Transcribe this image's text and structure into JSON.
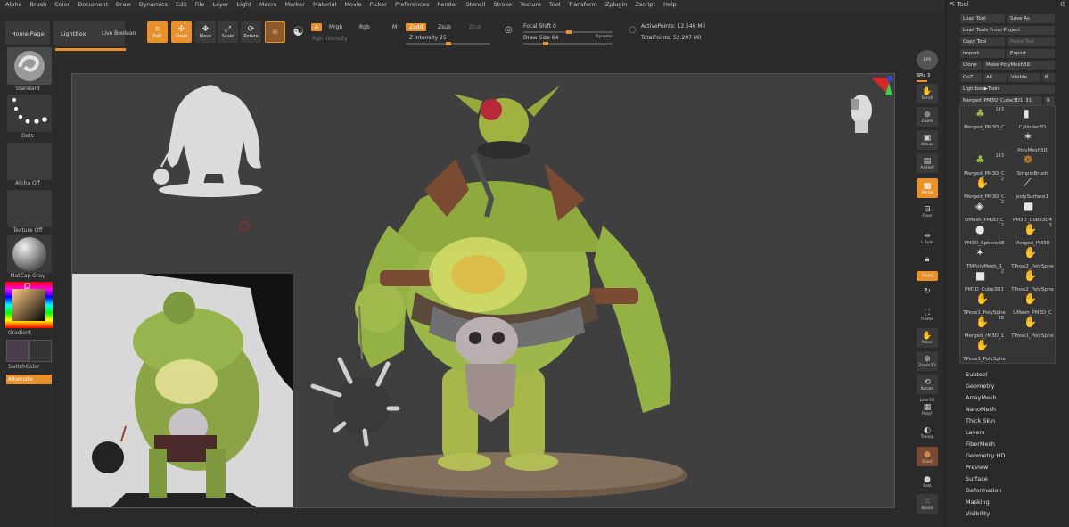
{
  "menubar": [
    "Alpha",
    "Brush",
    "Color",
    "Document",
    "Draw",
    "Dynamics",
    "Edit",
    "File",
    "Layer",
    "Light",
    "Macro",
    "Marker",
    "Material",
    "Movie",
    "Picker",
    "Preferences",
    "Render",
    "Stencil",
    "Stroke",
    "Texture",
    "Tool",
    "Transform",
    "Zplugin",
    "Zscript",
    "Help"
  ],
  "shelf": {
    "home_page": "Home Page",
    "lightbox": "LightBox",
    "live_boolean": "Live Boolean",
    "edit": "Edit",
    "draw": "Draw",
    "move": "Move",
    "scale": "Scale",
    "rotate": "Rotate",
    "a_chip": "A",
    "mrgb": "Mrgb",
    "rgb": "Rgb",
    "m": "M",
    "rgb_intensity": "Rgb Intensity",
    "zadd": "Zadd",
    "zsub": "Zsub",
    "zcut": "Zcut",
    "z_intensity": "Z Intensity 25",
    "focal_shift": "Focal Shift 0",
    "draw_size": "Draw Size 64",
    "dynamic": "Dynamic",
    "active_points": "ActivePoints: 12.546 Mil",
    "total_points": "TotalPoints: 52.207 Mil"
  },
  "left": {
    "standard": "Standard",
    "dots": "Dots",
    "alpha_off": "Alpha Off",
    "texture_off": "Texture Off",
    "matcap": "MatCap Gray",
    "gradient": "Gradient",
    "switch_color": "SwitchColor",
    "alternate": "Alternate"
  },
  "right": {
    "bpr": "BPR",
    "spix": "SPix 3",
    "scroll": "Scroll",
    "zoom": "Zoom",
    "actual": "Actual",
    "aahalf": "AAHalf",
    "persp": "Persp",
    "floor": "Floor",
    "lsym": "L.Sym",
    "xyz": "Gxyz",
    "frame": "Frame",
    "move": "Move",
    "zoom3d": "Zoom3D",
    "rotate": "Rotate",
    "line_fill": "Line Fill",
    "polyf": "PolyF",
    "transp": "Transp",
    "ghost": "Ghost",
    "solo": "Solo",
    "xpose": "Xpose"
  },
  "tool": {
    "title": "Tool",
    "load_tool": "Load Tool",
    "save_as": "Save As",
    "load_from_project": "Load Tools From Project",
    "copy_tool": "Copy Tool",
    "paste_tool": "Paste Tool",
    "import": "Import",
    "export": "Export",
    "clone": "Clone",
    "make_polymesh": "Make PolyMesh3D",
    "goz": "GoZ",
    "all": "All",
    "visible": "Visible",
    "r": "R",
    "lightbox_tools": "Lightbox▶Tools",
    "current_tool": "Merged_PM3D_Cube3D1_31",
    "r2": "R",
    "thumbs": [
      {
        "cap": "Merged_PM3D_C",
        "cnt": "143",
        "icon": "ogre-icon"
      },
      {
        "cap": "Cylinder3D",
        "cnt": "",
        "icon": "cylinder-icon"
      },
      {
        "cap": "",
        "cnt": "",
        "icon": ""
      },
      {
        "cap": "PolyMesh3D",
        "cnt": "",
        "icon": "star-icon"
      },
      {
        "cap": "Merged_PM3D_C",
        "cnt": "143",
        "icon": "ogre-icon"
      },
      {
        "cap": "SimpleBrush",
        "cnt": "",
        "icon": "brush-icon"
      },
      {
        "cap": "Merged_PM3D_C",
        "cnt": "2",
        "icon": "hand-icon"
      },
      {
        "cap": "polySurface1",
        "cnt": "",
        "icon": "stroke-icon"
      },
      {
        "cap": "UMesh_PM3D_C",
        "cnt": "2",
        "icon": "mesh-icon"
      },
      {
        "cap": "PM3D_Cube3D4",
        "cnt": "",
        "icon": "cube-icon"
      },
      {
        "cap": "PM3D_Sphere3E",
        "cnt": "2",
        "icon": "sphere-icon"
      },
      {
        "cap": "Merged_PM3D",
        "cnt": "5",
        "icon": "hand-icon"
      },
      {
        "cap": "TMPolyMesh_1",
        "cnt": "",
        "icon": "star-icon"
      },
      {
        "cap": "TPose2_PolySphe",
        "cnt": "",
        "icon": "hand-icon"
      },
      {
        "cap": "PM3D_Cube3D1",
        "cnt": "2",
        "icon": "cube-icon"
      },
      {
        "cap": "TPose2_PolySphe",
        "cnt": "",
        "icon": "hand-icon"
      },
      {
        "cap": "TPose1_PolySphe",
        "cnt": "",
        "icon": "hand-icon"
      },
      {
        "cap": "UMesh_PM3D_C",
        "cnt": "",
        "icon": "hand-icon"
      },
      {
        "cap": "Merged_rM3D_1",
        "cnt": "18",
        "icon": "hand-icon"
      },
      {
        "cap": "TPose1_PolySphe",
        "cnt": "",
        "icon": "hand-icon"
      },
      {
        "cap": "TPose1_PolySphe",
        "cnt": "",
        "icon": "hand-icon"
      },
      {
        "cap": "",
        "cnt": "",
        "icon": ""
      }
    ],
    "subpalettes": [
      "Subtool",
      "Geometry",
      "ArrayMesh",
      "NanoMesh",
      "Thick Skin",
      "Layers",
      "FiberMesh",
      "Geometry HD",
      "Preview",
      "Surface",
      "Deformation",
      "Masking",
      "Visibility"
    ]
  },
  "colors": {
    "accent": "#e8912d",
    "ogre_skin": "#9cb84a",
    "bg": "#2a2a2a",
    "canvas": "#3f3f3f"
  }
}
